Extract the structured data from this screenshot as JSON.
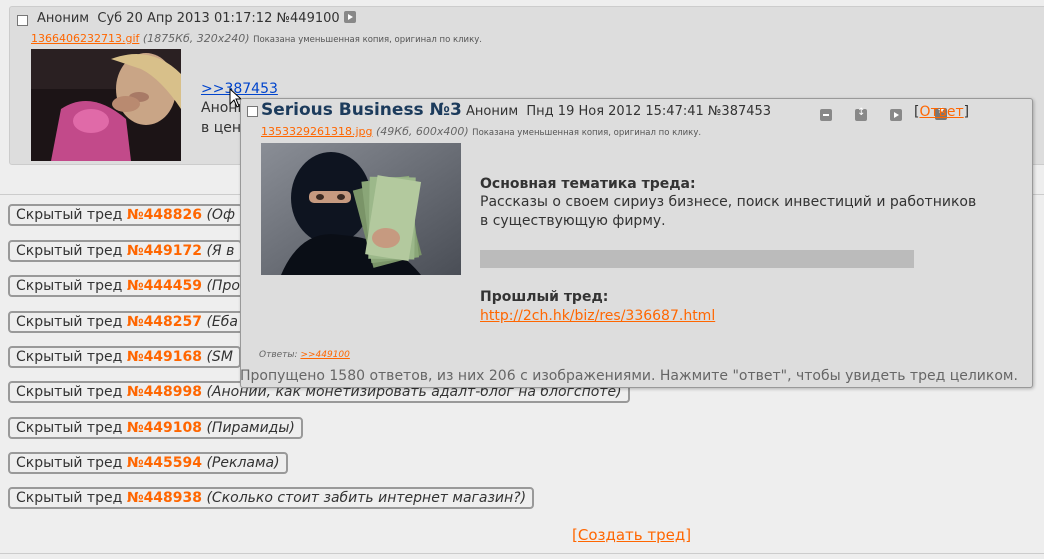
{
  "top_post": {
    "author": "Аноним",
    "date": "Суб 20 Апр 2013 01:17:12",
    "number": "№449100",
    "file_name": "1366406232713.gif",
    "file_meta": "(1875Кб, 320x240)",
    "file_note": "Показана уменьшенная копия, оригинал по клику.",
    "reply_link": ">>387453",
    "text_line1": "Аноним",
    "text_line2": "в цен"
  },
  "popup": {
    "subject": "Serious Business №3",
    "author": "Аноним",
    "date": "Пнд 19 Ноя 2012 15:47:41",
    "number": "№387453",
    "reply_open": "[",
    "reply_label": "Ответ",
    "reply_close": "]",
    "file_name": "1353329261318.jpg",
    "file_meta": "(49Кб, 600x400)",
    "file_note": "Показана уменьшенная копия, оригинал по клику.",
    "heading1": "Основная тематика треда:",
    "body_line1": "Рассказы о своем сириуз бизнесе, поиск инвестиций и работников",
    "body_line2": "в существующую фирму.",
    "heading2": "Прошлый тред:",
    "prev_link": "http://2ch.hk/biz/res/336687.html",
    "replies_label": "Ответы:",
    "replies_link": ">>449100"
  },
  "omitted": "Пропущено 1580 ответов, из них 206 с изображениями. Нажмите \"ответ\", чтобы увидеть тред целиком.",
  "hidden_threads": [
    {
      "label": "Скрытый тред",
      "number": "№448826",
      "subject": "(Оф"
    },
    {
      "label": "Скрытый тред",
      "number": "№449172",
      "subject": "(Я в"
    },
    {
      "label": "Скрытый тред",
      "number": "№444459",
      "subject": "(Про"
    },
    {
      "label": "Скрытый тред",
      "number": "№448257",
      "subject": "(Еба"
    },
    {
      "label": "Скрытый тред",
      "number": "№449168",
      "subject": "(SM"
    },
    {
      "label": "Скрытый тред",
      "number": "№448998",
      "subject": "(Аноний, как монетизировать адалт-блог на блогспоте)"
    },
    {
      "label": "Скрытый тред",
      "number": "№449108",
      "subject": "(Пирамиды)"
    },
    {
      "label": "Скрытый тред",
      "number": "№445594",
      "subject": "(Реклама)"
    },
    {
      "label": "Скрытый тред",
      "number": "№448938",
      "subject": "(Сколько стоит забить интернет магазин?)"
    }
  ],
  "create_thread": "[Создать тред]"
}
